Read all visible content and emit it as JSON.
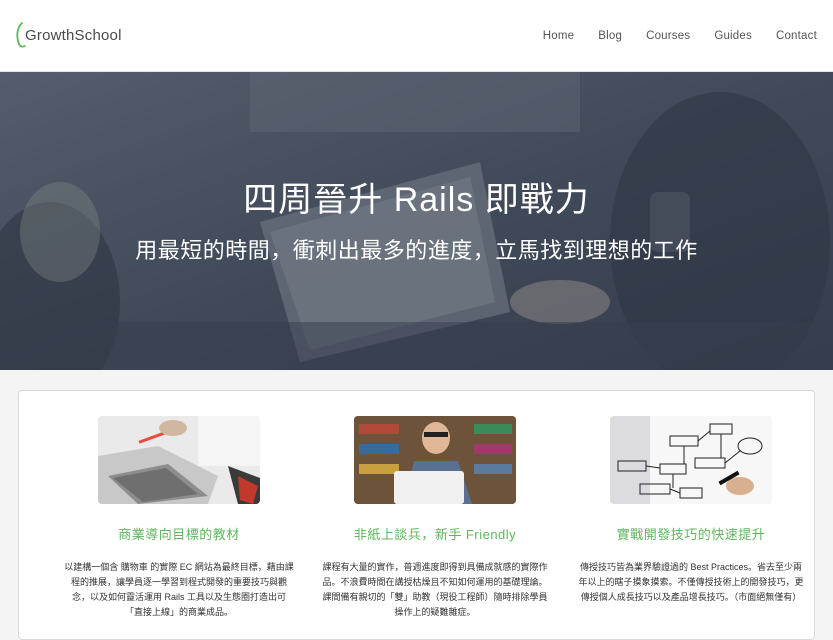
{
  "brand": {
    "name": "GrowthSchool",
    "accent": "#5cb85c"
  },
  "nav": {
    "items": [
      {
        "label": "Home"
      },
      {
        "label": "Blog"
      },
      {
        "label": "Courses"
      },
      {
        "label": "Guides"
      },
      {
        "label": "Contact"
      }
    ]
  },
  "hero": {
    "title": "四周晉升 Rails 即戰力",
    "subtitle": "用最短的時間，衝刺出最多的進度，立馬找到理想的工作"
  },
  "features": [
    {
      "title": "商業導向目標的教材",
      "text": "以建構一個含 購物車 的實際 EC 網站為最終目標，藉由課程的推展，讓學員逐一學習到程式開發的重要技巧與觀念，以及如何靈活運用 Rails 工具以及生態圈打造出可「直接上線」的商業成品。"
    },
    {
      "title": "非紙上談兵，新手 Friendly",
      "text": "課程有大量的實作，普週進度即得到具備成就感的實際作品。不浪費時間在講授枯燥且不知如何運用的基礎理論。課間備有親切的「雙」助教（現役工程師）隨時排除學員操作上的疑難雜症。"
    },
    {
      "title": "實戰開發技巧的快速提升",
      "text": "傳授技巧皆為業界驗證過的 Best Practices。省去至少兩年以上的瞎子摸象摸索。不僅傳授技術上的開發技巧，更傳授個人成長技巧以及產品增長技巧。（市面絕無僅有）"
    }
  ]
}
